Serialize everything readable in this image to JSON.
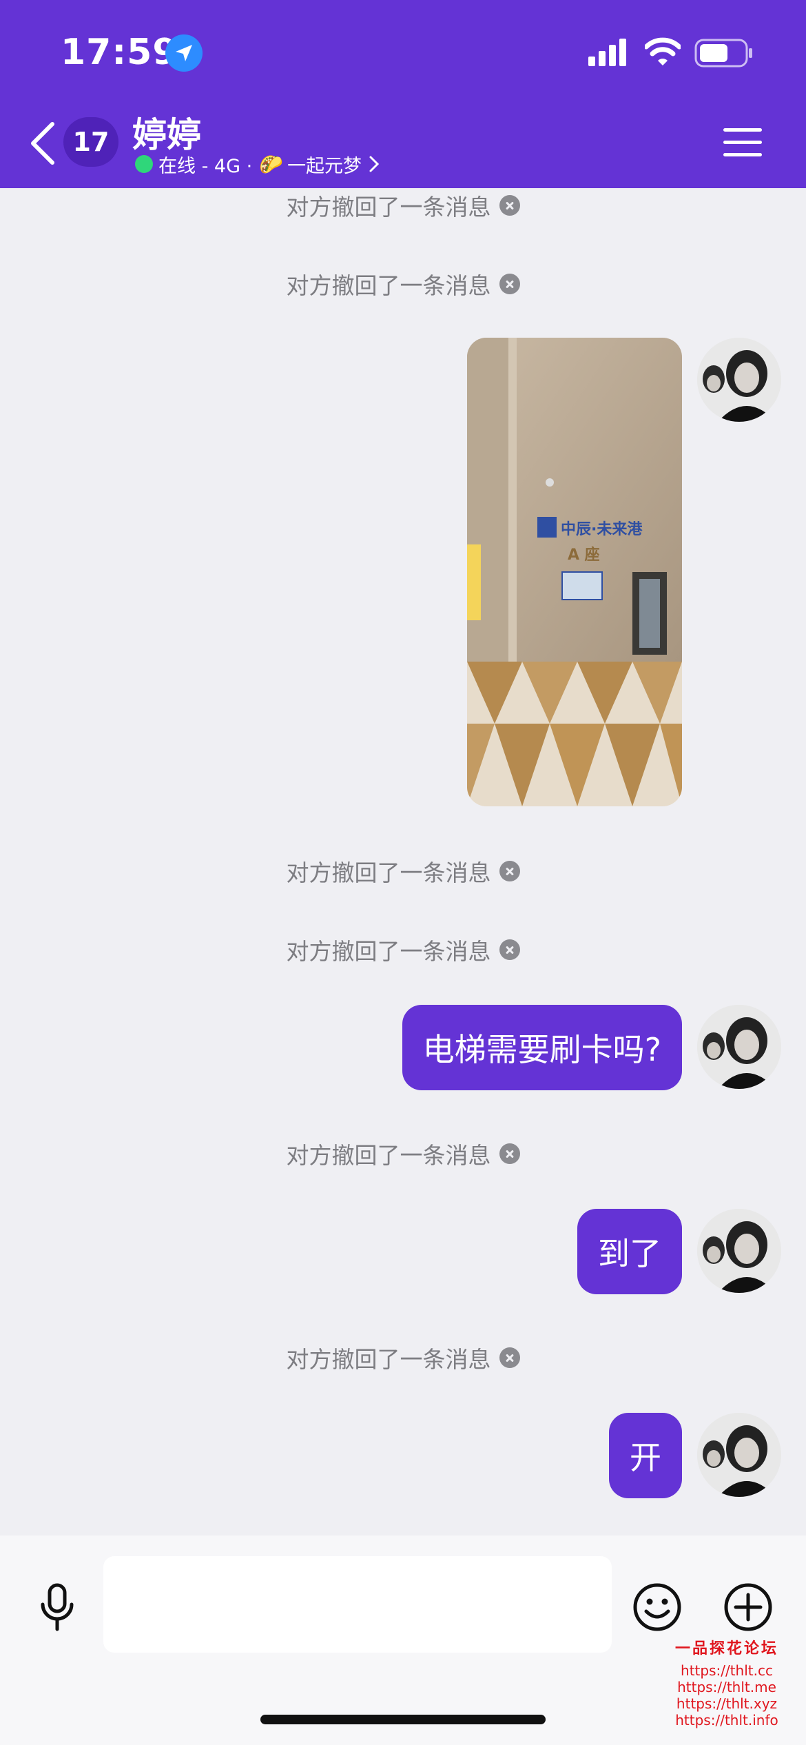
{
  "status_bar": {
    "time": "17:59",
    "location_icon": "location-arrow-icon",
    "signal_icon": "cellular-signal-icon",
    "wifi_icon": "wifi-icon",
    "battery_icon": "battery-icon",
    "battery_level": 0.6
  },
  "header": {
    "back_icon": "chevron-left-icon",
    "unread_count": "17",
    "title": "婷婷",
    "online_status": "在线 - 4G · ",
    "activity_emoji": "🌮",
    "activity": "一起元梦",
    "menu_icon": "hamburger-menu-icon",
    "online_color": "#2fd67a"
  },
  "messages": [
    {
      "type": "recall",
      "text": "对方撤回了一条消息"
    },
    {
      "type": "recall",
      "text": "对方撤回了一条消息"
    },
    {
      "type": "image",
      "side": "right",
      "description_icon": "photo-lobby"
    },
    {
      "type": "recall",
      "text": "对方撤回了一条消息"
    },
    {
      "type": "recall",
      "text": "对方撤回了一条消息"
    },
    {
      "type": "text",
      "side": "right",
      "text": "电梯需要刷卡吗?"
    },
    {
      "type": "recall",
      "text": "对方撤回了一条消息"
    },
    {
      "type": "text",
      "side": "right",
      "text": "到了"
    },
    {
      "type": "recall",
      "text": "对方撤回了一条消息"
    },
    {
      "type": "text",
      "side": "right",
      "text": "开"
    }
  ],
  "photo_sign": {
    "company": "中辰·未来港",
    "block": "A 座"
  },
  "input_bar": {
    "mic_icon": "microphone-icon",
    "placeholder": "",
    "emoji_icon": "smiley-face-icon",
    "plus_icon": "plus-circle-icon"
  },
  "watermark": {
    "title": "一品探花论坛",
    "urls": [
      "https://thlt.cc",
      "https://thlt.me",
      "https://thlt.xyz",
      "https://thlt.info"
    ]
  },
  "colors": {
    "brand_purple": "#6433d5",
    "background": "#efeff3",
    "watermark_red": "#e0161e"
  }
}
